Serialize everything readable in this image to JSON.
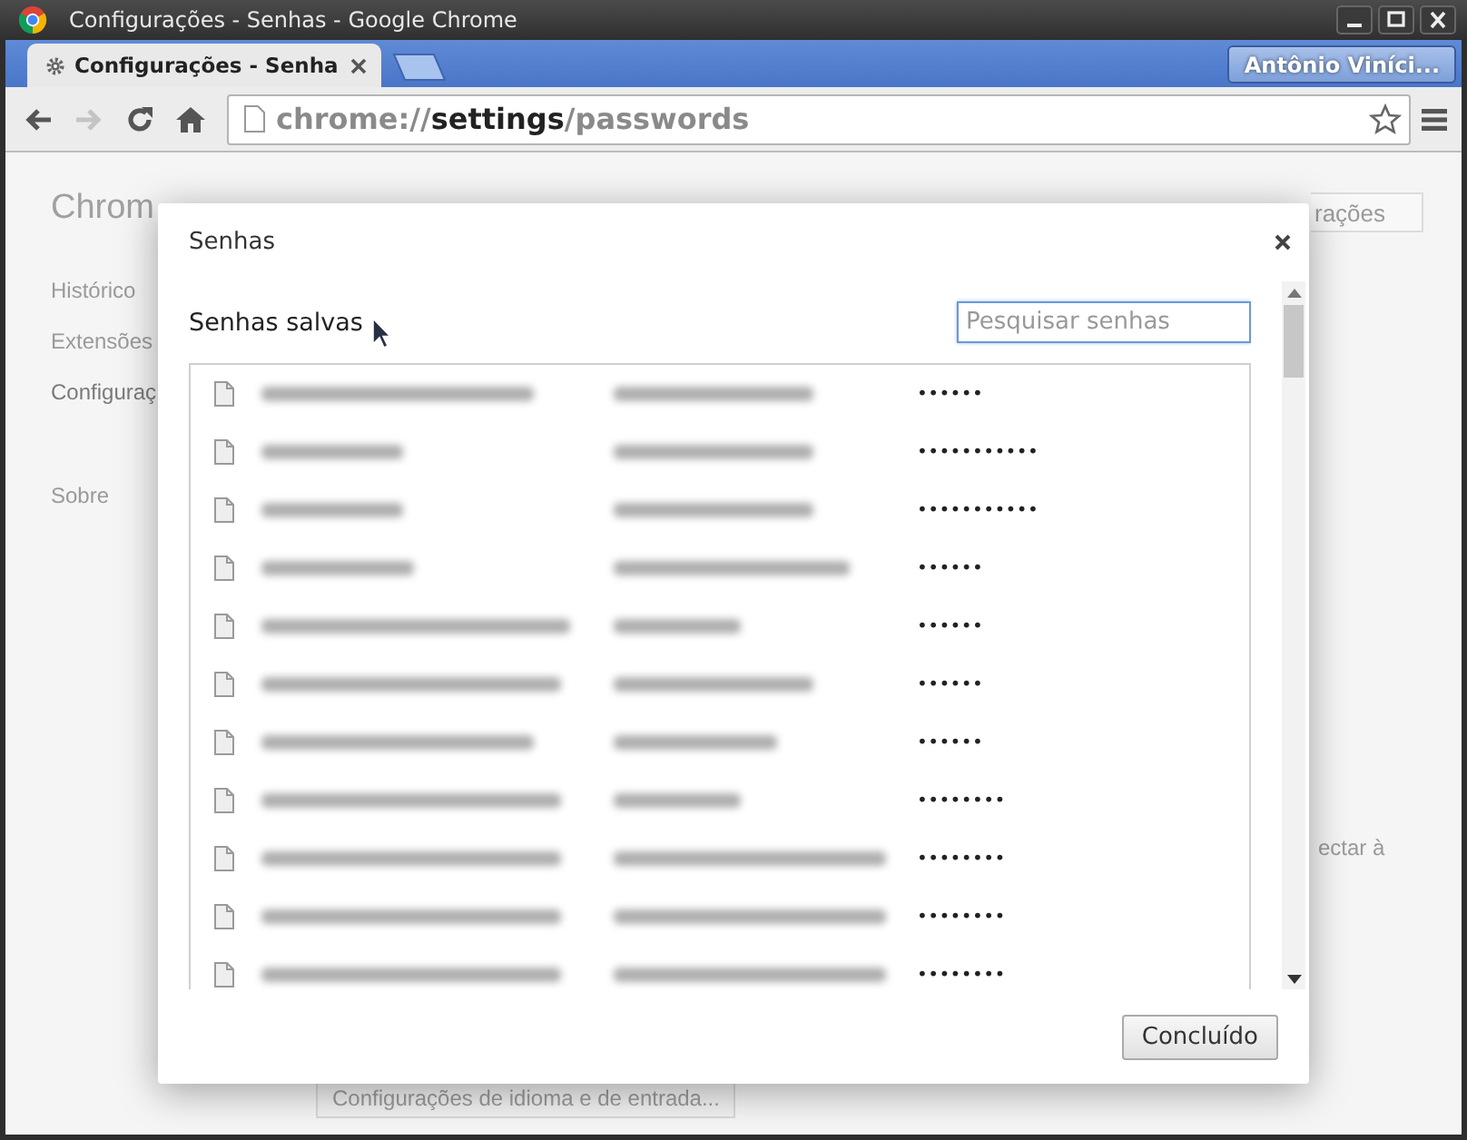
{
  "window": {
    "title": "Configurações - Senhas - Google Chrome"
  },
  "tabs": [
    {
      "label": "Configurações - Senha",
      "selected": true
    }
  ],
  "profile": "Antônio Viníci...",
  "nav_buttons": [
    {
      "kind": "back",
      "disabled": false
    },
    {
      "kind": "forward",
      "disabled": true
    },
    {
      "kind": "reload",
      "disabled": false
    },
    {
      "kind": "home",
      "disabled": false
    }
  ],
  "address_bar": {
    "scheme": "chrome://",
    "host": "settings",
    "path": "/passwords"
  },
  "settings_page": {
    "title": "Chrom",
    "nav": [
      {
        "label": "Histórico",
        "selected": false
      },
      {
        "label": "Extensões",
        "selected": false
      },
      {
        "label": "Configuraç",
        "selected": true
      },
      {
        "label": "Sobre",
        "selected": false
      }
    ],
    "search_fragment": "rações",
    "side_text": "ectar à",
    "bottom_button": "Configurações de idioma e de entrada..."
  },
  "dialog": {
    "title": "Senhas",
    "section": "Senhas salvas",
    "search": {
      "placeholder": "Pesquisar senhas",
      "focused": true
    },
    "rows": [
      {
        "password": "••••••"
      },
      {
        "password": "•••••••••••"
      },
      {
        "password": "•••••••••••"
      },
      {
        "password": "••••••"
      },
      {
        "password": "••••••"
      },
      {
        "password": "••••••"
      },
      {
        "password": "••••••"
      },
      {
        "password": "••••••••"
      },
      {
        "password": "••••••••"
      },
      {
        "password": "••••••••"
      },
      {
        "password": "••••••••"
      }
    ],
    "done_button": "Concluído"
  }
}
